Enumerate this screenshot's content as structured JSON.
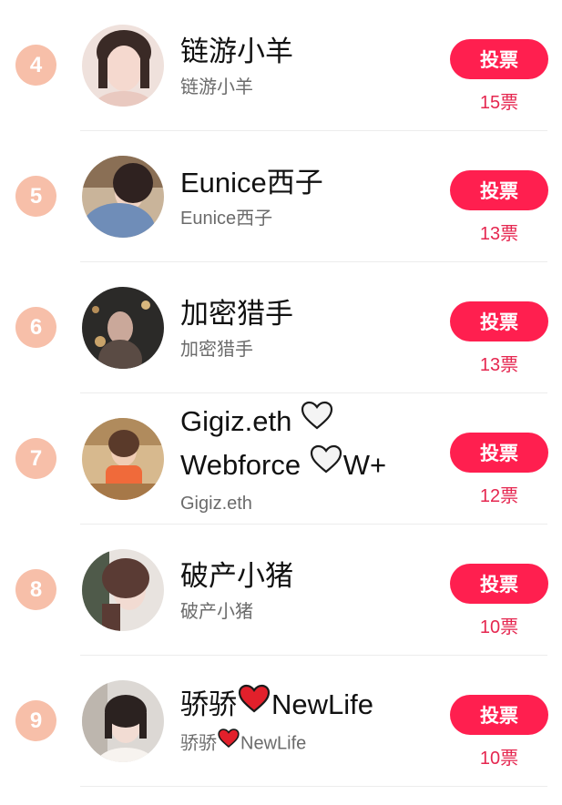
{
  "vote_button_label": "投票",
  "colors": {
    "rank_badge": "#f7bfa9",
    "vote_button": "#ff1f4f",
    "vote_count": "#e5264f"
  },
  "entries": [
    {
      "rank": "4",
      "name": "链游小羊",
      "username": "链游小羊",
      "votes": "15票",
      "avatar": "avatar-photo"
    },
    {
      "rank": "5",
      "name": "Eunice西子",
      "username": "Eunice西子",
      "votes": "13票",
      "avatar": "avatar-photo"
    },
    {
      "rank": "6",
      "name": "加密猎手",
      "username": "加密猎手",
      "votes": "13票",
      "avatar": "avatar-photo"
    },
    {
      "rank": "7",
      "name_line1": "Gigiz.eth",
      "name_line2_a": "Webforce",
      "name_line2_b": "W+",
      "username": "Gigiz.eth",
      "votes": "12票",
      "avatar": "avatar-photo",
      "icons": [
        "white-heart-icon",
        "white-heart-icon"
      ]
    },
    {
      "rank": "8",
      "name": "破产小猪",
      "username": "破产小猪",
      "votes": "10票",
      "avatar": "avatar-photo"
    },
    {
      "rank": "9",
      "name_a": "骄骄",
      "name_b": "NewLife",
      "username_a": "骄骄",
      "username_b": "NewLife",
      "votes": "10票",
      "avatar": "avatar-photo",
      "icons": [
        "red-heart-icon"
      ]
    }
  ]
}
